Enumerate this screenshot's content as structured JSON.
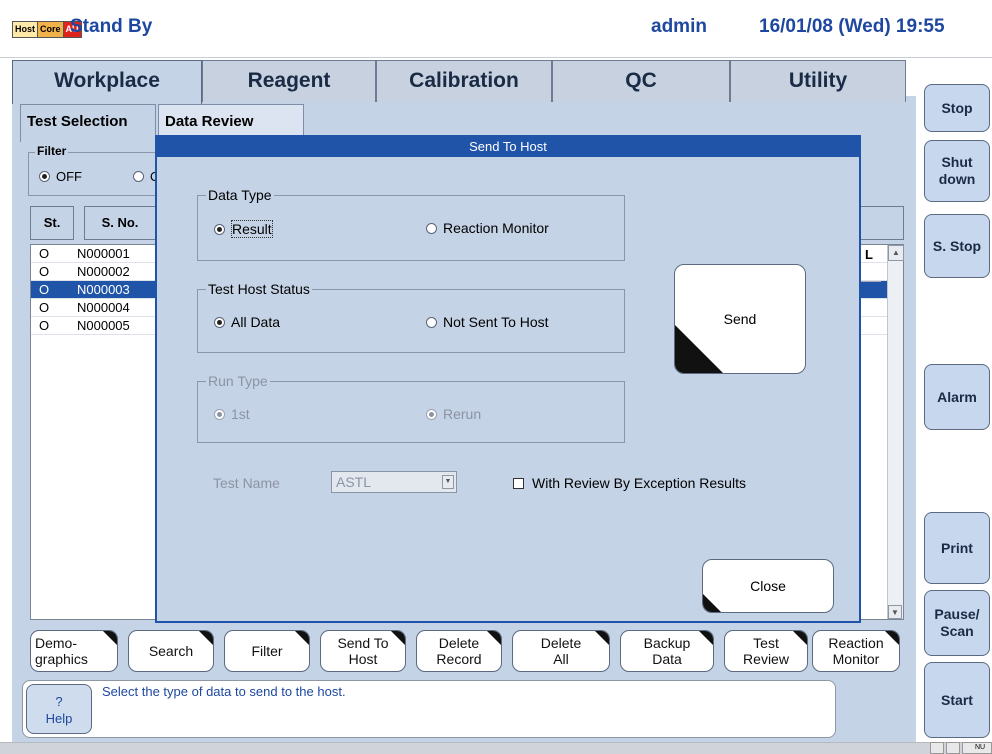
{
  "status_bar": {
    "indicators": [
      "Host",
      "Core",
      "AU"
    ],
    "system_status": "Stand By",
    "user": "admin",
    "datetime": "16/01/08 (Wed) 19:55"
  },
  "main_tabs": [
    "Workplace",
    "Reagent",
    "Calibration",
    "QC",
    "Utility"
  ],
  "sub_tabs": [
    "Test Selection",
    "Data Review"
  ],
  "filter": {
    "legend": "Filter",
    "option_off": "OFF",
    "option_on": "O"
  },
  "list": {
    "headers": [
      "St.",
      "S. No."
    ],
    "right_cell": "L",
    "rows": [
      {
        "st": "O",
        "sno": "N000001"
      },
      {
        "st": "O",
        "sno": "N000002"
      },
      {
        "st": "O",
        "sno": "N000003"
      },
      {
        "st": "O",
        "sno": "N000004"
      },
      {
        "st": "O",
        "sno": "N000005"
      }
    ]
  },
  "bottom_buttons": [
    "Demo-\ngraphics",
    "Search",
    "Filter",
    "Send To\nHost",
    "Delete\nRecord",
    "Delete\nAll",
    "Backup\nData",
    "Test\nReview",
    "Reaction\nMonitor"
  ],
  "help": {
    "label": "Help",
    "icon": "?",
    "message": "Select the type of data to send to the host."
  },
  "right_buttons": [
    "Stop",
    "Shut\ndown",
    "S. Stop",
    "Alarm",
    "Print",
    "Pause/\nScan",
    "Start"
  ],
  "dialog": {
    "title": "Send To Host",
    "data_type": {
      "legend": "Data Type",
      "opt1": "Result",
      "opt2": "Reaction Monitor"
    },
    "host_status": {
      "legend": "Test Host Status",
      "opt1": "All Data",
      "opt2": "Not Sent To Host"
    },
    "run_type": {
      "legend": "Run Type",
      "opt1": "1st",
      "opt2": "Rerun"
    },
    "test_name_label": "Test Name",
    "test_name_value": "ASTL",
    "checkbox_label": "With Review By Exception Results",
    "send_label": "Send",
    "close_label": "Close"
  },
  "footer_text": "NU"
}
